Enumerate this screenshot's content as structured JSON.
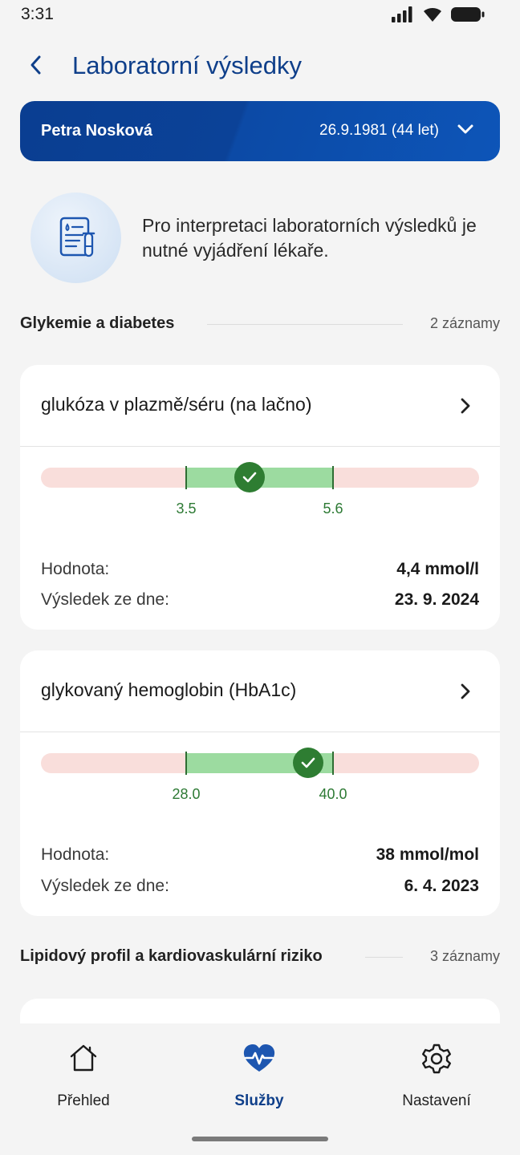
{
  "status_bar": {
    "time": "3:31"
  },
  "header": {
    "title": "Laboratorní výsledky"
  },
  "patient": {
    "name": "Petra Nosková",
    "dob": "26.9.1981 (44 let)"
  },
  "info": {
    "text": "Pro interpretaci laboratorních výsledků je nutné vyjádření lékaře."
  },
  "sections": [
    {
      "title": "Glykemie a diabetes",
      "count": "2 záznamy"
    },
    {
      "title": "Lipidový profil a kardiovaskulární riziko",
      "count": "3 záznamy"
    }
  ],
  "results": [
    {
      "title": "glukóza v plazmě/séru (na lačno)",
      "range_low": "3.5",
      "range_high": "5.6",
      "value_label": "Hodnota:",
      "value": "4,4 mmol/l",
      "date_label": "Výsledek ze dne:",
      "date": "23. 9. 2024",
      "status": "normal"
    },
    {
      "title": "glykovaný hemoglobin (HbA1c)",
      "range_low": "28.0",
      "range_high": "40.0",
      "value_label": "Hodnota:",
      "value": "38 mmol/mol",
      "date_label": "Výsledek ze dne:",
      "date": "6. 4. 2023",
      "status": "normal"
    }
  ],
  "bottom_nav": {
    "items": [
      {
        "label": "Přehled",
        "icon": "home-icon"
      },
      {
        "label": "Služby",
        "icon": "heart-pulse-icon",
        "active": true
      },
      {
        "label": "Nastavení",
        "icon": "gear-icon"
      }
    ]
  },
  "colors": {
    "primary": "#0f3f8a",
    "range_ok": "#9cdba0",
    "range_out": "#f9dedb",
    "marker": "#2e7d32"
  }
}
